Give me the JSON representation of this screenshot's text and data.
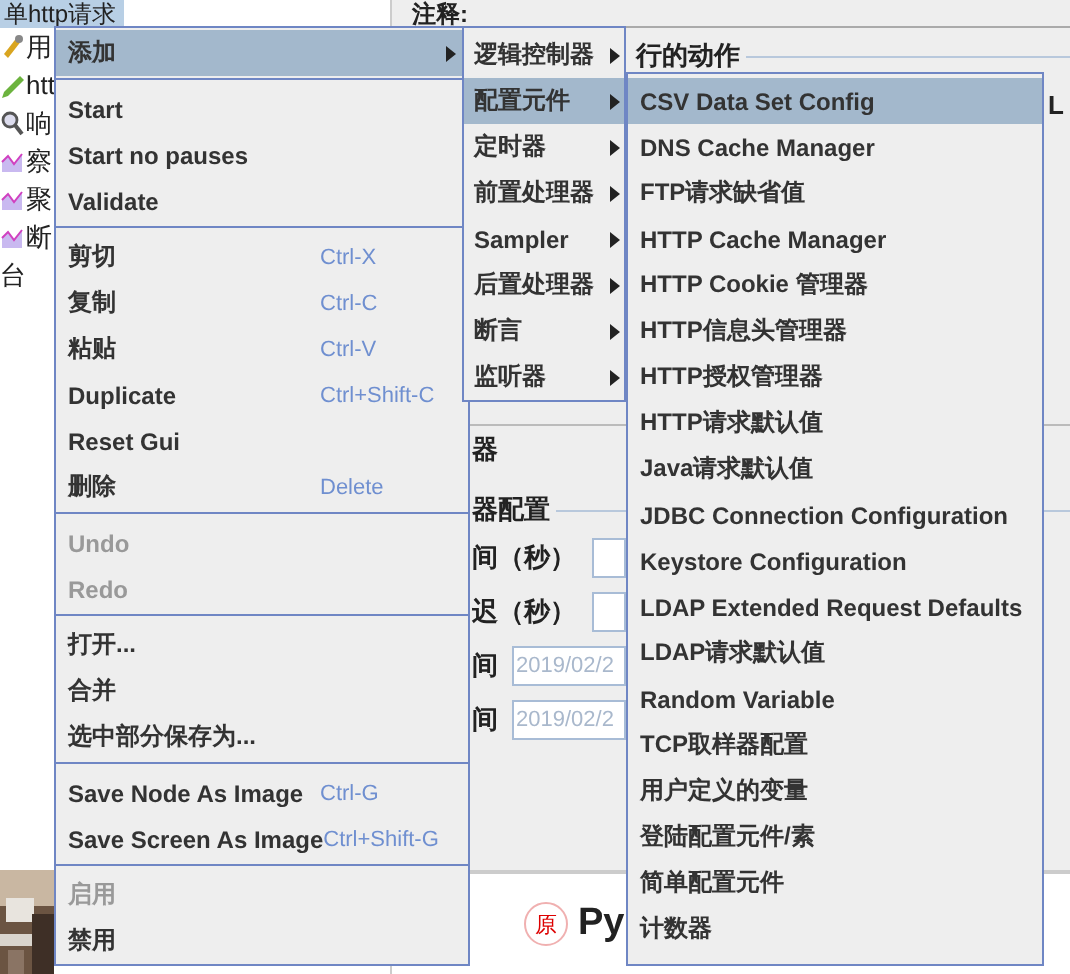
{
  "tree": {
    "root": {
      "label": "单http请求",
      "selected": true
    },
    "items": [
      {
        "label": "用",
        "kind": "tool"
      },
      {
        "label": "htt",
        "kind": "edit"
      },
      {
        "label": "响",
        "kind": "view"
      },
      {
        "label": "察",
        "kind": "listener"
      },
      {
        "label": "聚",
        "kind": "listener"
      },
      {
        "label": "断",
        "kind": "listener"
      },
      {
        "label": "台",
        "kind": "plain"
      }
    ]
  },
  "panel": {
    "comment_label": "注释:",
    "section_legend": "行的动作",
    "cut_text": "L",
    "fragment": "器",
    "config_legend": "器配置",
    "fields": [
      {
        "label": "间（秒）"
      },
      {
        "label": "迟（秒）"
      },
      {
        "label": "间",
        "value": "2019/02/2"
      },
      {
        "label": "间",
        "value": "2019/02/2"
      }
    ],
    "footer": {
      "badge": "原",
      "title": "Py"
    }
  },
  "context_menu": {
    "items": [
      {
        "kind": "submenu",
        "label": "添加",
        "selected": true
      },
      {
        "kind": "separator"
      },
      {
        "kind": "item",
        "label": "Start",
        "disabled": false
      },
      {
        "kind": "item",
        "label": "Start no pauses",
        "disabled": false
      },
      {
        "kind": "item",
        "label": "Validate",
        "disabled": false
      },
      {
        "kind": "separator"
      },
      {
        "kind": "item",
        "label": "剪切",
        "shortcut": "Ctrl-X",
        "disabled": false
      },
      {
        "kind": "item",
        "label": "复制",
        "shortcut": "Ctrl-C",
        "disabled": false
      },
      {
        "kind": "item",
        "label": "粘贴",
        "shortcut": "Ctrl-V",
        "disabled": false
      },
      {
        "kind": "item",
        "label": "Duplicate",
        "shortcut": "Ctrl+Shift-C",
        "disabled": false
      },
      {
        "kind": "item",
        "label": "Reset Gui",
        "disabled": false
      },
      {
        "kind": "item",
        "label": "删除",
        "shortcut": "Delete",
        "disabled": false
      },
      {
        "kind": "separator"
      },
      {
        "kind": "item",
        "label": "Undo",
        "disabled": true
      },
      {
        "kind": "item",
        "label": "Redo",
        "disabled": true
      },
      {
        "kind": "separator"
      },
      {
        "kind": "item",
        "label": "打开...",
        "disabled": false
      },
      {
        "kind": "item",
        "label": "合并",
        "disabled": false
      },
      {
        "kind": "item",
        "label": "选中部分保存为...",
        "disabled": false
      },
      {
        "kind": "separator"
      },
      {
        "kind": "item",
        "label": "Save Node As Image",
        "shortcut": "Ctrl-G",
        "disabled": false
      },
      {
        "kind": "item",
        "label": "Save Screen As Image",
        "shortcut": "Ctrl+Shift-G",
        "disabled": false
      },
      {
        "kind": "separator"
      },
      {
        "kind": "item",
        "label": "启用",
        "disabled": true
      },
      {
        "kind": "item",
        "label": "禁用",
        "disabled": false
      }
    ]
  },
  "add_submenu": {
    "items": [
      {
        "label": "逻辑控制器",
        "selected": false
      },
      {
        "label": "配置元件",
        "selected": true
      },
      {
        "label": "定时器",
        "selected": false
      },
      {
        "label": "前置处理器",
        "selected": false
      },
      {
        "label": "Sampler",
        "selected": false
      },
      {
        "label": "后置处理器",
        "selected": false
      },
      {
        "label": "断言",
        "selected": false
      },
      {
        "label": "监听器",
        "selected": false
      }
    ]
  },
  "config_submenu": {
    "items": [
      {
        "label": "CSV Data Set Config",
        "selected": true
      },
      {
        "label": "DNS Cache Manager",
        "selected": false
      },
      {
        "label": "FTP请求缺省值",
        "selected": false
      },
      {
        "label": "HTTP Cache Manager",
        "selected": false
      },
      {
        "label": "HTTP Cookie 管理器",
        "selected": false
      },
      {
        "label": "HTTP信息头管理器",
        "selected": false
      },
      {
        "label": "HTTP授权管理器",
        "selected": false
      },
      {
        "label": "HTTP请求默认值",
        "selected": false
      },
      {
        "label": "Java请求默认值",
        "selected": false
      },
      {
        "label": "JDBC Connection Configuration",
        "selected": false
      },
      {
        "label": "Keystore Configuration",
        "selected": false
      },
      {
        "label": "LDAP Extended Request Defaults",
        "selected": false
      },
      {
        "label": "LDAP请求默认值",
        "selected": false
      },
      {
        "label": "Random Variable",
        "selected": false
      },
      {
        "label": "TCP取样器配置",
        "selected": false
      },
      {
        "label": "用户定义的变量",
        "selected": false
      },
      {
        "label": "登陆配置元件/素",
        "selected": false
      },
      {
        "label": "简单配置元件",
        "selected": false
      },
      {
        "label": "计数器",
        "selected": false
      }
    ]
  }
}
